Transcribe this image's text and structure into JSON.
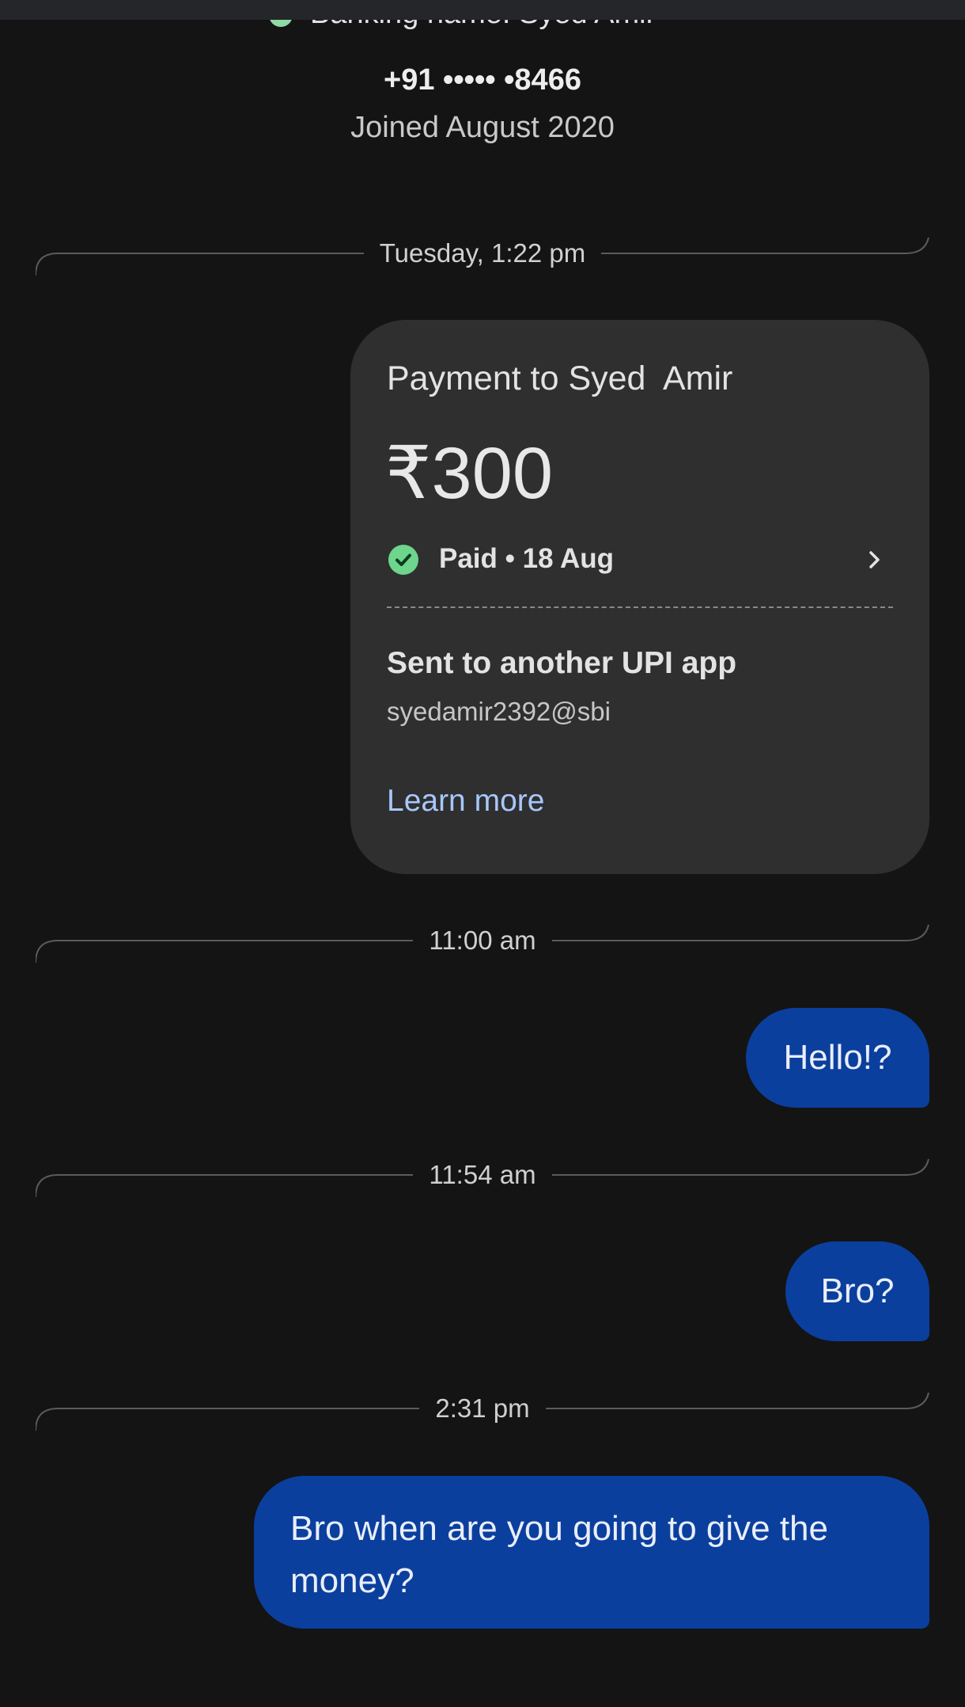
{
  "header": {
    "banking_name": "Banking name: Syed  Amir",
    "phone": "+91 ••••• •8466",
    "joined": "Joined August 2020"
  },
  "dividers": [
    {
      "label": "Tuesday, 1:22 pm"
    },
    {
      "label": "11:00 am"
    },
    {
      "label": "11:54 am"
    },
    {
      "label": "2:31 pm"
    }
  ],
  "payment_card": {
    "title": "Payment to Syed  Amir",
    "amount": "₹300",
    "status": "Paid • 18 Aug",
    "sent_title": "Sent to another UPI app",
    "upi_id": "syedamir2392@sbi",
    "learn_more": "Learn more",
    "status_color": "#6dd58c"
  },
  "messages": [
    {
      "text": "Hello!?"
    },
    {
      "text": "Bro?"
    },
    {
      "text": "Bro when are you going to give the money?"
    }
  ],
  "colors": {
    "background": "#141414",
    "card": "#2f2f30",
    "bubble": "#0b3f9e",
    "link": "#a8c7fa"
  }
}
